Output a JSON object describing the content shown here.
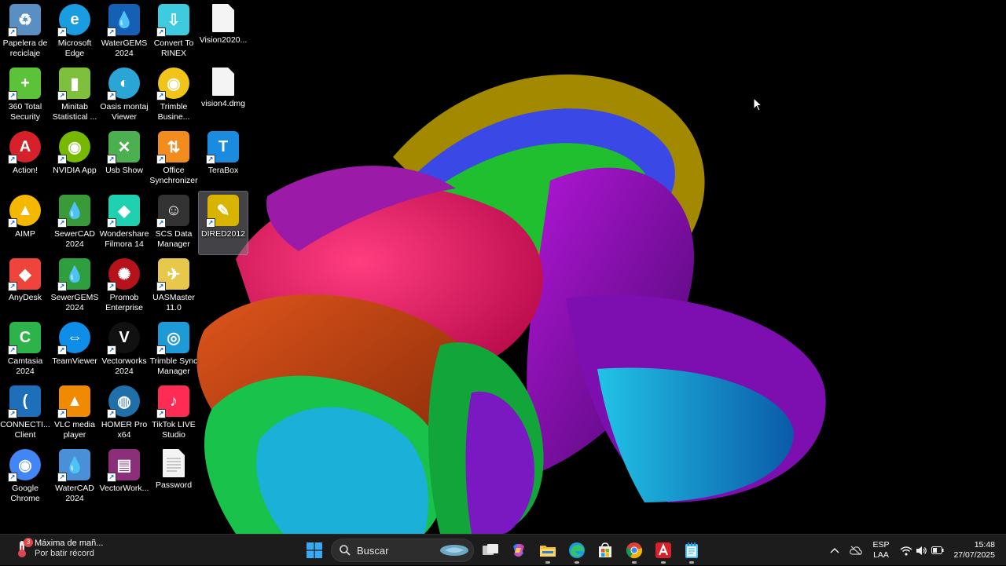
{
  "desktop": {
    "icons": [
      {
        "label": "Papelera de reciclaje",
        "icon": "recycle-bin",
        "color": "#5a8fc4"
      },
      {
        "label": "Microsoft Edge",
        "icon": "edge",
        "color": "#1a9de0"
      },
      {
        "label": "WaterGEMS 2024",
        "icon": "drop",
        "color": "#1560b5"
      },
      {
        "label": "Convert To RINEX",
        "icon": "rinex",
        "color": "#3ecbe0"
      },
      {
        "label": "Vision2020...",
        "icon": "document",
        "color": "#f4f4f4"
      },
      {
        "label": "360 Total Security",
        "icon": "plus-shield",
        "color": "#5cc23a"
      },
      {
        "label": "Minitab Statistical ...",
        "icon": "bar-chart",
        "color": "#7ebf3e"
      },
      {
        "label": "Oasis montaj Viewer",
        "icon": "oasis",
        "color": "#2aa5d6"
      },
      {
        "label": "Trimble Busine...",
        "icon": "trimble",
        "color": "#f0c419"
      },
      {
        "label": "vision4.dmg",
        "icon": "document",
        "color": "#f4f4f4"
      },
      {
        "label": "Action!",
        "icon": "action",
        "color": "#d6202a"
      },
      {
        "label": "NVIDIA App",
        "icon": "nvidia",
        "color": "#76b900"
      },
      {
        "label": "Usb Show",
        "icon": "wrench",
        "color": "#4cb050"
      },
      {
        "label": "Office Synchronizer",
        "icon": "sync-arrows",
        "color": "#f28c1e"
      },
      {
        "label": "TeraBox",
        "icon": "terabox",
        "color": "#1b8be0"
      },
      {
        "label": "AIMP",
        "icon": "aimp",
        "color": "#f5b800"
      },
      {
        "label": "SewerCAD 2024",
        "icon": "drop",
        "color": "#3a9a3a"
      },
      {
        "label": "Wondershare Filmora 14",
        "icon": "filmora",
        "color": "#1fd1b0"
      },
      {
        "label": "SCS Data Manager",
        "icon": "people",
        "color": "#333333"
      },
      {
        "label": "DIRED2012",
        "icon": "dired",
        "color": "#d8b400"
      },
      {
        "label": "AnyDesk",
        "icon": "anydesk",
        "color": "#ef443b"
      },
      {
        "label": "SewerGEMS 2024",
        "icon": "drop",
        "color": "#2f9e3e"
      },
      {
        "label": "Promob Enterprise",
        "icon": "promob",
        "color": "#b5121b"
      },
      {
        "label": "UASMaster 11.0",
        "icon": "uas",
        "color": "#e8c84a"
      },
      {
        "label": "Camtasia 2024",
        "icon": "camtasia",
        "color": "#2cb34a"
      },
      {
        "label": "TeamViewer",
        "icon": "teamviewer",
        "color": "#0e8ee9"
      },
      {
        "label": "Vectorworks 2024",
        "icon": "vectorworks",
        "color": "#111111"
      },
      {
        "label": "Trimble Sync Manager",
        "icon": "trimble-sync",
        "color": "#1e9bd7"
      },
      {
        "label": "CONNECTI... Client",
        "icon": "connect",
        "color": "#1c6fb8"
      },
      {
        "label": "VLC media player",
        "icon": "vlc",
        "color": "#f08a00"
      },
      {
        "label": "HOMER Pro x64",
        "icon": "homer",
        "color": "#1f6fa8"
      },
      {
        "label": "TikTok LIVE Studio",
        "icon": "tiktok",
        "color": "#fe2c55"
      },
      {
        "label": "Google Chrome",
        "icon": "chrome",
        "color": "#4285f4"
      },
      {
        "label": "WaterCAD 2024",
        "icon": "drop",
        "color": "#4a90d9"
      },
      {
        "label": "VectorWork...",
        "icon": "winrar",
        "color": "#8b2f7a"
      },
      {
        "label": "Password",
        "icon": "text-file",
        "color": "#f4f4f4"
      }
    ]
  },
  "taskbar": {
    "weather": {
      "line1": "Máxima de mañ...",
      "line2": "Por batir récord",
      "badge": "3"
    },
    "search_placeholder": "Buscar",
    "pinned": [
      {
        "name": "start",
        "icon": "windows-icon"
      },
      {
        "name": "task-view",
        "icon": "task-view-icon"
      },
      {
        "name": "copilot",
        "icon": "copilot-icon"
      },
      {
        "name": "file-explorer",
        "icon": "folder-icon"
      },
      {
        "name": "edge",
        "icon": "edge-icon"
      },
      {
        "name": "store",
        "icon": "store-icon"
      },
      {
        "name": "chrome",
        "icon": "chrome-icon"
      },
      {
        "name": "action",
        "icon": "action-icon"
      },
      {
        "name": "notepad",
        "icon": "notepad-icon"
      }
    ],
    "tray": {
      "lang_line1": "ESP",
      "lang_line2": "LAA",
      "time": "15:48",
      "date": "27/07/2025"
    }
  }
}
